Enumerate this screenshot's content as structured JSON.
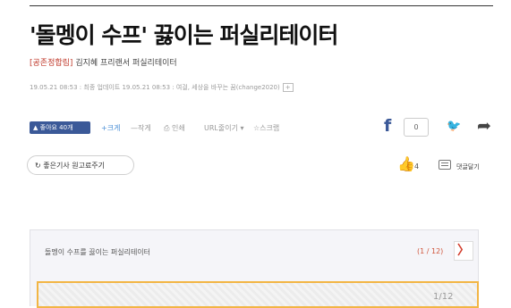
{
  "article": {
    "headline": "'돌멩이 수프' 끓이는 퍼실리테이터",
    "byline_tag": "[공존정합림]",
    "byline_author": "김지혜 프리랜서 퍼실리테이터",
    "meta_line": "19.05.21 08:53 : 최종 업데이트 19.05.21 08:53 : 여걸, 세상을 바꾸는 꿈(change2020)",
    "meta_box": "+"
  },
  "toolbar": {
    "like_label": "좋아요 40개",
    "font_plus": "+크게",
    "font_minus": "—작게",
    "print": "인쇄",
    "url_copy": "URL줄이기",
    "scrap": "스크랩",
    "facebook_glyph": "f",
    "share_count": "0",
    "twitter_glyph": "🐦",
    "share_glyph": "➦"
  },
  "actions": {
    "recommend_label": "좋은기사 원고료주기",
    "recommend_icon": "↻",
    "thumb_glyph": "👍",
    "thumb_count": "4",
    "comment_label": "댓글달기"
  },
  "gallery": {
    "title": "돌멩이 수프를 끓이는 퍼실리테이터",
    "counter": "(1 / 12)",
    "next_glyph": "〉",
    "slide_index": "1/12"
  }
}
